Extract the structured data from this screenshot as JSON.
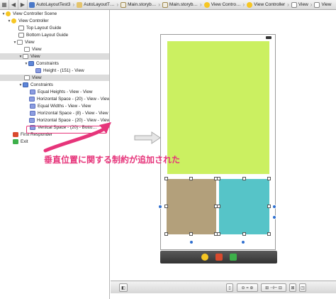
{
  "jumpbar": {
    "crumbs": [
      "AutoLayoutTest3",
      "AutoLayoutT…",
      "Main.storyb…",
      "Main.storyb…",
      "View Contro…",
      "View Controller",
      "View",
      "View"
    ]
  },
  "outline": {
    "rows": [
      {
        "label": "View Controller Scene",
        "icon": "scene-icon"
      },
      {
        "label": "View Controller",
        "icon": "view-controller-icon"
      },
      {
        "label": "Top Layout Guide",
        "icon": "layout-guide-icon"
      },
      {
        "label": "Bottom Layout Guide",
        "icon": "layout-guide-icon"
      },
      {
        "label": "View",
        "icon": "view-icon"
      },
      {
        "label": "View",
        "icon": "view-icon"
      },
      {
        "label": "View",
        "icon": "view-icon"
      },
      {
        "label": "Constraints",
        "icon": "constraints-icon"
      },
      {
        "label": "Height - (151) - View",
        "icon": "constraint-icon"
      },
      {
        "label": "View",
        "icon": "view-icon"
      },
      {
        "label": "Constraints",
        "icon": "constraints-icon"
      },
      {
        "label": "Equal Heights - View - View",
        "icon": "constraint-icon"
      },
      {
        "label": "Horizontal Space - (20) - View - View",
        "icon": "constraint-icon"
      },
      {
        "label": "Equal Widths - View - View",
        "icon": "constraint-icon"
      },
      {
        "label": "Horizontal Space - (8) - View - View",
        "icon": "constraint-icon"
      },
      {
        "label": "Horizontal Space - (20) - View - View",
        "icon": "constraint-icon"
      },
      {
        "label": "Vertical Space - (20) - Botto…",
        "icon": "constraint-icon"
      },
      {
        "label": "First Responder",
        "icon": "first-responder-icon"
      },
      {
        "label": "Exit",
        "icon": "exit-icon"
      }
    ]
  },
  "annotation": {
    "text": "垂直位置に関する制約が追加された"
  },
  "colors": {
    "green_view": "#cbf061",
    "brown_view": "#b3a07b",
    "teal_view": "#56c4c8",
    "annotation": "#e6347a",
    "constraint_dot": "#2f6fd0"
  },
  "bottombar": {
    "buttons": [
      "panel-toggle",
      "constraints-align",
      "pin",
      "resolve",
      "resizing",
      "zoom"
    ]
  }
}
